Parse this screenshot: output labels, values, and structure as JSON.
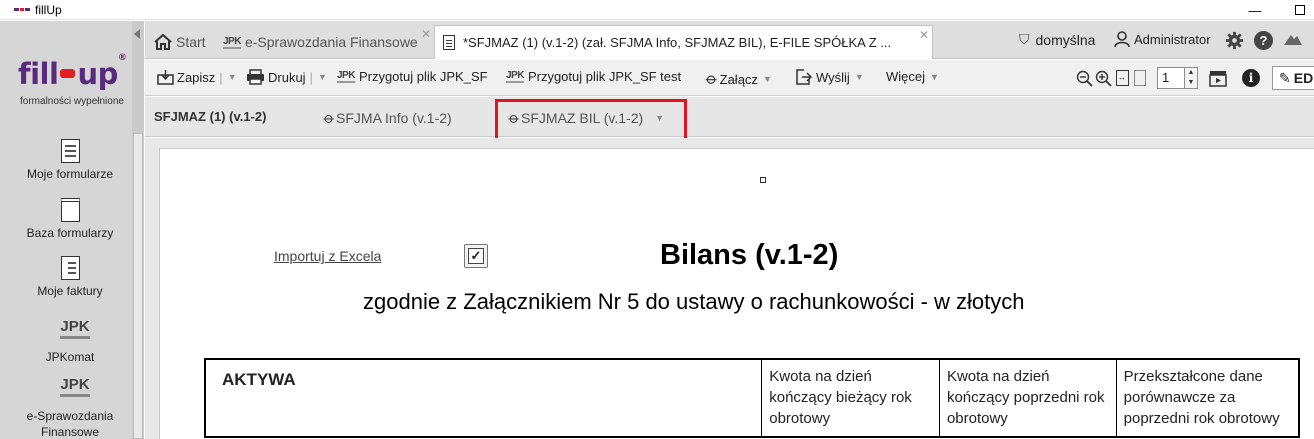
{
  "window": {
    "title": "fillUp"
  },
  "sidebar": {
    "logo_text_left": "fill",
    "logo_text_right": "up",
    "logo_reg": "®",
    "tagline": "formalności wypełnione",
    "items": [
      {
        "label": "Moje formularze",
        "icon": "form-list-icon"
      },
      {
        "label": "Baza formularzy",
        "icon": "notepad-icon"
      },
      {
        "label": "Moje faktury",
        "icon": "invoice-icon"
      },
      {
        "label": "JPKomat",
        "icon": "jpk-icon"
      },
      {
        "label": "e-Sprawozdania Finansowe",
        "icon": "jpk-icon"
      }
    ],
    "jpk_text": "JPK"
  },
  "tabs": [
    {
      "label": "Start",
      "icon": "home-icon"
    },
    {
      "label": "e-Sprawozdania Finansowe",
      "icon": "jpk-icon",
      "prefix": "JPK"
    },
    {
      "label": "*SFJMAZ (1) (v.1-2) (zał. SFJMA Info, SFJMAZ BIL), E-FILE SPÓŁKA Z ...",
      "icon": "document-icon",
      "active": true
    }
  ],
  "header_right": {
    "profile": "domyślna",
    "user": "Administrator"
  },
  "toolbar": {
    "save": "Zapisz",
    "print": "Drukuj",
    "prepare_jpk": "Przygotuj plik JPK_SF",
    "prepare_jpk_test": "Przygotuj plik JPK_SF test",
    "attach": "Załącz",
    "send": "Wyślij",
    "more": "Więcej",
    "page": "1",
    "edit_label": "ED",
    "jpk_text": "JPK"
  },
  "subtabs": [
    {
      "label": "SFJMAZ (1) (v.1-2)"
    },
    {
      "label": "SFJMA Info (v.1-2)"
    },
    {
      "label": "SFJMAZ BIL (v.1-2)"
    }
  ],
  "document": {
    "import_link": "Importuj z Excela",
    "checkbox_mark": "✓",
    "title": "Bilans (v.1-2)",
    "subtitle": "zgodnie z Załącznikiem Nr 5 do ustawy o rachunkowości - w złotych",
    "table_headers": [
      "AKTYWA",
      "Kwota na dzień kończący bieżący rok obrotowy",
      "Kwota na dzień kończący poprzedni rok obrotowy",
      "Przekształcone dane porównawcze za poprzedni rok obrotowy"
    ]
  },
  "colors": {
    "brand_purple": "#5a2a7e",
    "brand_red": "#e31e24",
    "highlight_red": "#e0141e"
  }
}
